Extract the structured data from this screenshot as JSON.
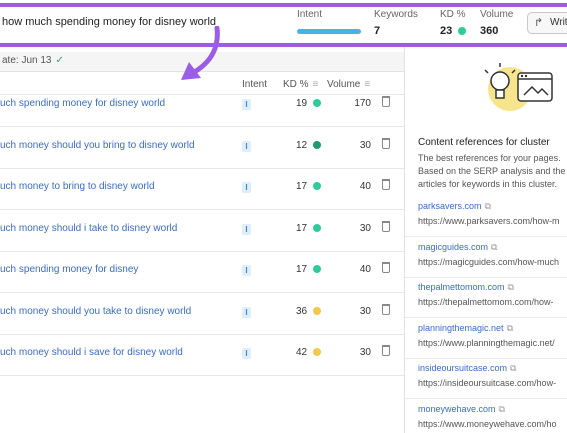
{
  "header": {
    "query": "how much spending money for disney world",
    "intent_label": "Intent",
    "keywords_label": "Keywords",
    "keywords_value": "7",
    "kd_label": "KD %",
    "kd_value": "23",
    "kd_color": "#2ecc9a",
    "volume_label": "Volume",
    "volume_value": "360",
    "write_label": "Write"
  },
  "update": {
    "text": "ate: Jun 13"
  },
  "table": {
    "columns": {
      "intent": "Intent",
      "kd": "KD %",
      "volume": "Volume"
    },
    "rows": [
      {
        "keyword": "uch spending money for disney world",
        "intent": "I",
        "kd": "19",
        "kd_color": "#2ecc9a",
        "volume": "170"
      },
      {
        "keyword": "uch money should you bring to disney world",
        "intent": "I",
        "kd": "12",
        "kd_color": "#1b9a73",
        "volume": "30"
      },
      {
        "keyword": "uch money to bring to disney world",
        "intent": "I",
        "kd": "17",
        "kd_color": "#2ecc9a",
        "volume": "40"
      },
      {
        "keyword": "uch money should i take to disney world",
        "intent": "I",
        "kd": "17",
        "kd_color": "#2ecc9a",
        "volume": "30"
      },
      {
        "keyword": "uch spending money for disney",
        "intent": "I",
        "kd": "17",
        "kd_color": "#2ecc9a",
        "volume": "40"
      },
      {
        "keyword": "uch money should you take to disney world",
        "intent": "I",
        "kd": "36",
        "kd_color": "#f2c94c",
        "volume": "30"
      },
      {
        "keyword": "uch money should i save for disney world",
        "intent": "I",
        "kd": "42",
        "kd_color": "#f2c94c",
        "volume": "30"
      }
    ]
  },
  "panel": {
    "title": "Content references for cluster",
    "desc1": "The best references for your pages.",
    "desc2": "Based on the SERP analysis and the",
    "desc3": "articles for keywords in this cluster.",
    "refs": [
      {
        "domain": "parksavers.com",
        "url": "https://www.parksavers.com/how-m"
      },
      {
        "domain": "magicguides.com",
        "url": "https://magicguides.com/how-much"
      },
      {
        "domain": "thepalmettomom.com",
        "url": "https://thepalmettomom.com/how-"
      },
      {
        "domain": "planningthemagic.net",
        "url": "https://www.planningthemagic.net/"
      },
      {
        "domain": "insideoursuitcase.com",
        "url": "https://insideoursuitcase.com/how-"
      },
      {
        "domain": "moneywehave.com",
        "url": "https://www.moneywehave.com/ho"
      }
    ]
  }
}
